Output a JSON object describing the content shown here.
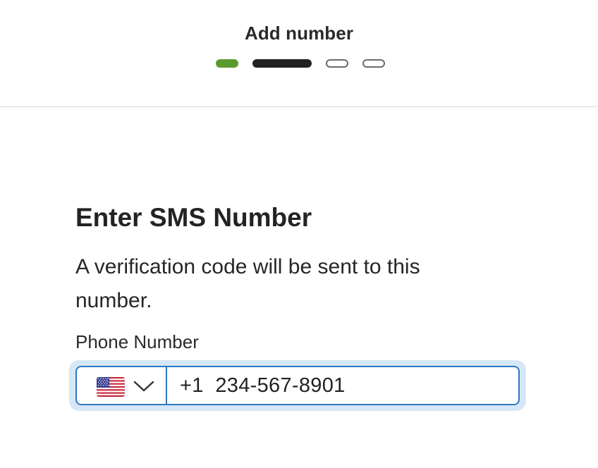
{
  "header": {
    "title": "Add number",
    "steps": [
      {
        "state": "completed",
        "color": "#5a9a2f"
      },
      {
        "state": "current",
        "color": "#222222"
      },
      {
        "state": "upcoming",
        "color": "#6b6b6b"
      },
      {
        "state": "upcoming",
        "color": "#6b6b6b"
      }
    ]
  },
  "form": {
    "heading": "Enter SMS Number",
    "description": "A verification code will be sent to this number.",
    "phone_label": "Phone Number",
    "country_code": "+1",
    "country_flag": "us-flag-icon",
    "phone_value": "234-567-8901",
    "focus_color": "#2e78c2"
  }
}
